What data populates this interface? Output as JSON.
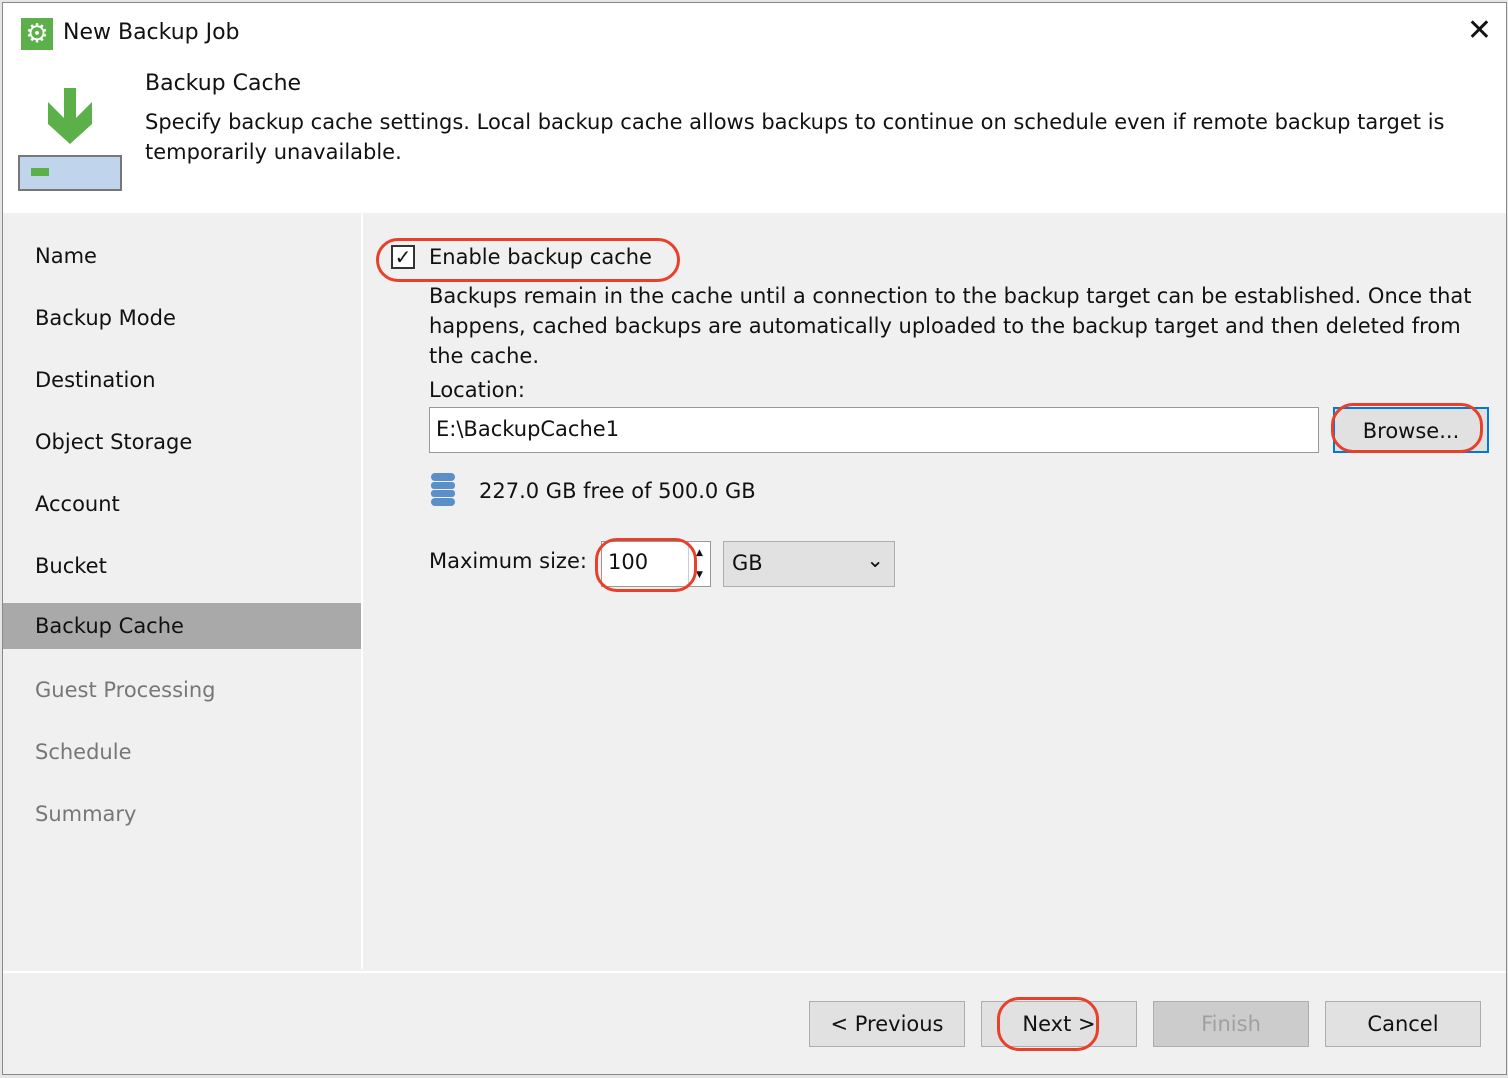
{
  "window": {
    "title": "New Backup Job",
    "app_icon": "gear-icon",
    "close_icon": "close-icon"
  },
  "header": {
    "title": "Backup Cache",
    "description": "Specify backup cache settings. Local backup cache allows backups to continue on schedule even if remote backup target is temporarily unavailable.",
    "icon": "download-to-disk-icon"
  },
  "sidebar": {
    "items": [
      {
        "label": "Name",
        "state": "normal"
      },
      {
        "label": "Backup Mode",
        "state": "normal"
      },
      {
        "label": "Destination",
        "state": "normal"
      },
      {
        "label": "Object Storage",
        "state": "normal"
      },
      {
        "label": "Account",
        "state": "normal"
      },
      {
        "label": "Bucket",
        "state": "normal"
      },
      {
        "label": "Backup Cache",
        "state": "active"
      },
      {
        "label": "Guest Processing",
        "state": "disabled"
      },
      {
        "label": "Schedule",
        "state": "disabled"
      },
      {
        "label": "Summary",
        "state": "disabled"
      }
    ]
  },
  "main": {
    "enable_cache": {
      "label": "Enable backup cache",
      "checked": true
    },
    "cache_description": "Backups remain in the cache until a connection to the backup target can be established. Once that happens, cached backups are automatically uploaded to the backup target and then deleted from the cache.",
    "location_label": "Location:",
    "location_value": "E:\\BackupCache1",
    "browse_label": "Browse...",
    "free_space": "227.0 GB free of 500.0 GB",
    "free_space_icon": "database-icon",
    "max_size_label": "Maximum size:",
    "max_size_value": "100",
    "unit_value": "GB"
  },
  "footer": {
    "previous": "< Previous",
    "next": "Next >",
    "finish": "Finish",
    "cancel": "Cancel"
  },
  "colors": {
    "accent": "#0078d7",
    "annotation": "#e8402a",
    "brand_green": "#5cb04a",
    "selected_nav": "#a9a9a9"
  }
}
